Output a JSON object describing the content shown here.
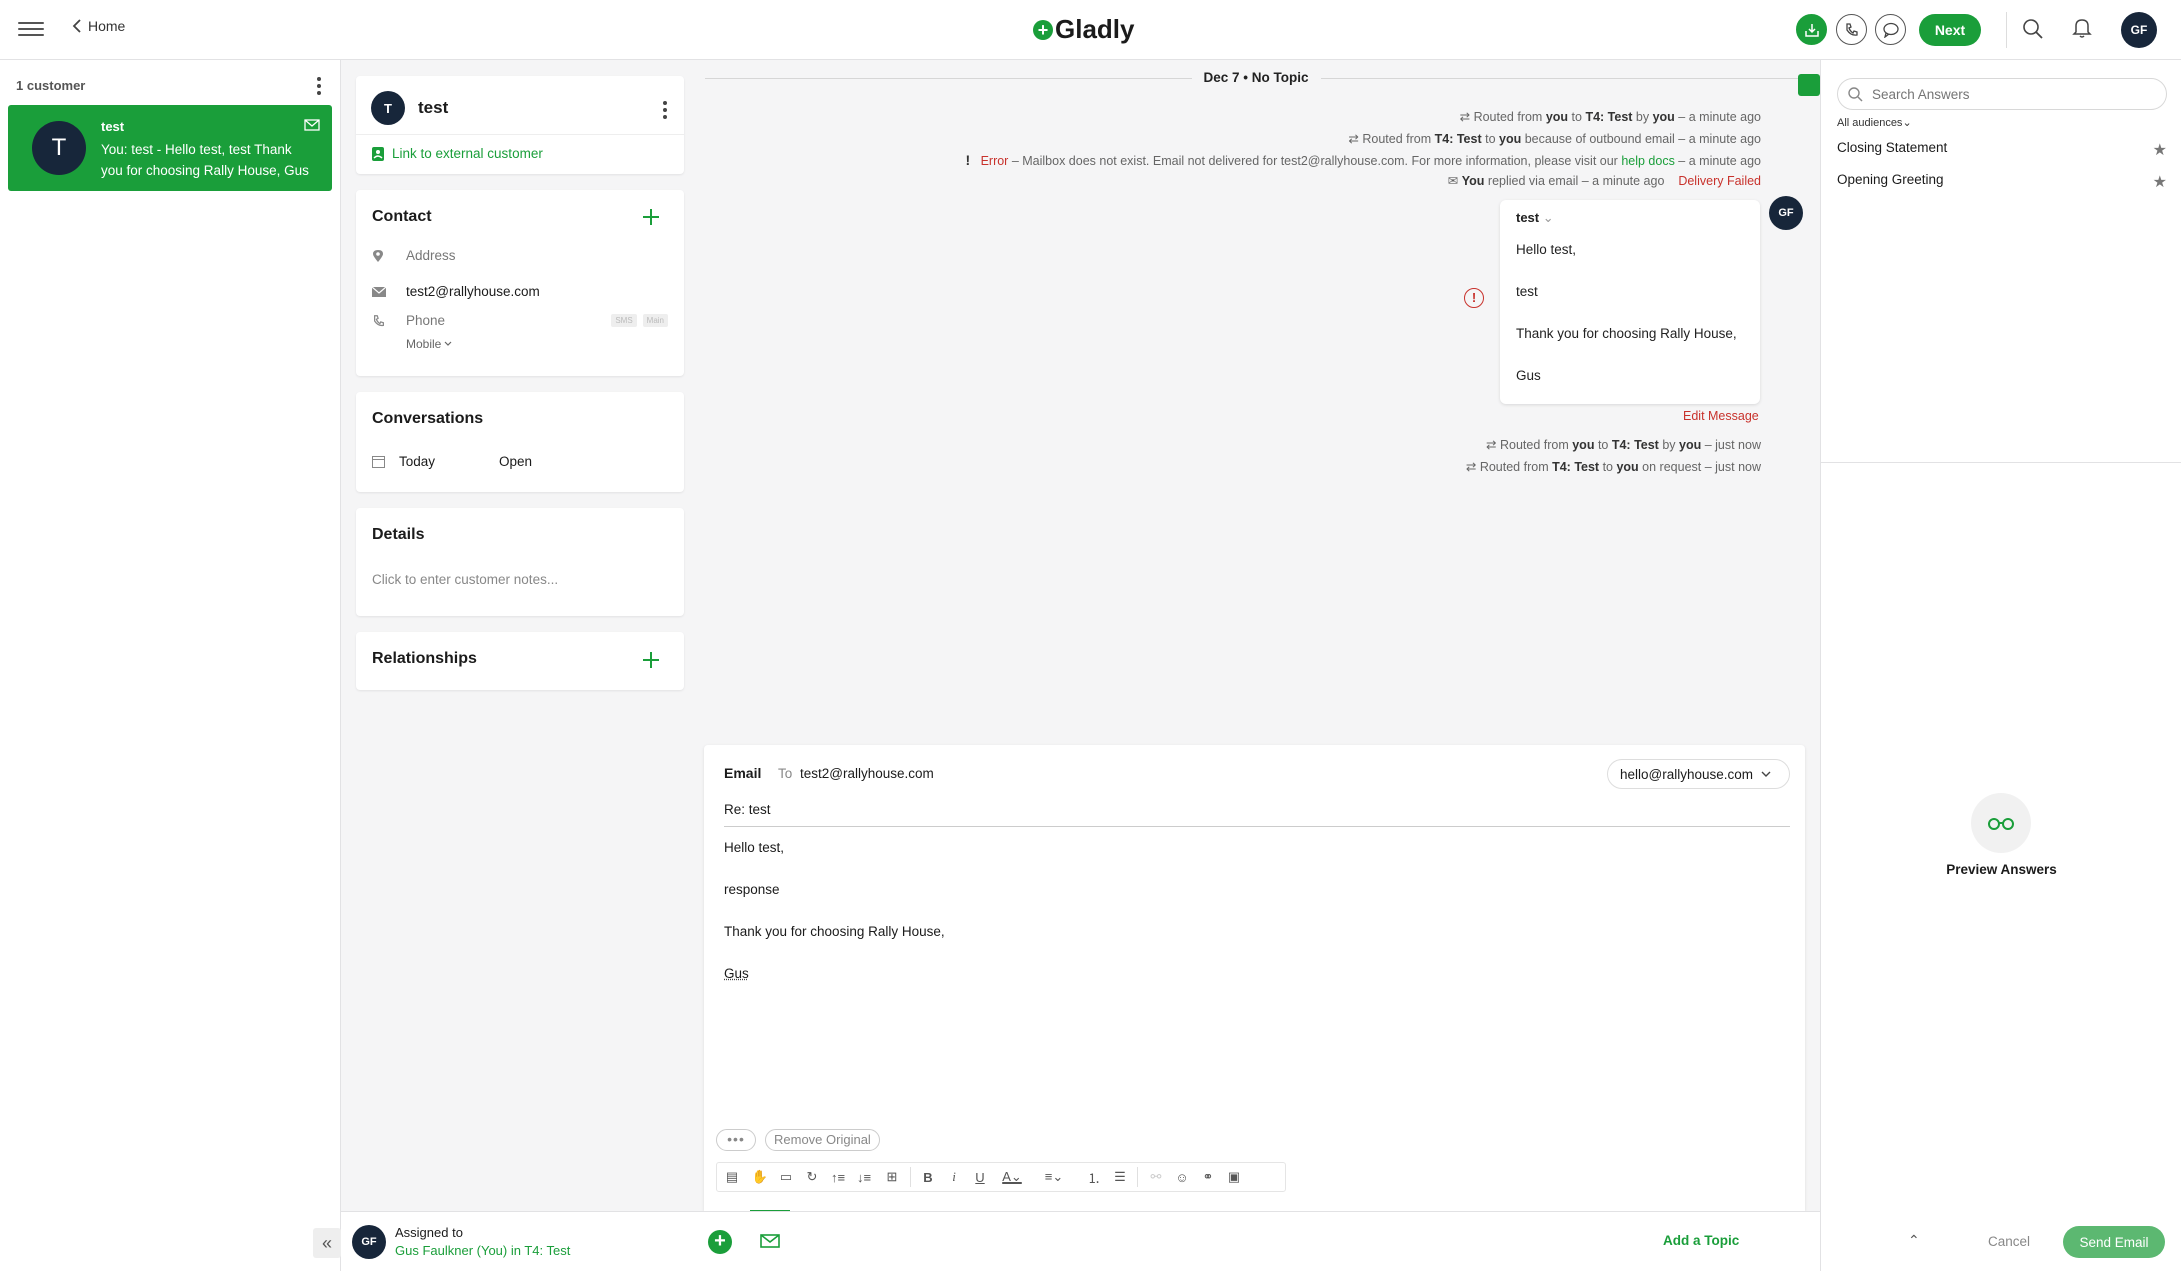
{
  "topbar": {
    "home_label": "Home",
    "brand": "Gladly",
    "next_label": "Next",
    "avatar_initials": "GF"
  },
  "customers": {
    "count_label": "1 customer",
    "items": [
      {
        "initial": "T",
        "name": "test",
        "preview": "You: test - Hello test, test Thank you for choosing Rally House, Gus"
      }
    ]
  },
  "profile": {
    "initial": "T",
    "name": "test",
    "link_external": "Link to external customer"
  },
  "contact": {
    "title": "Contact",
    "address_placeholder": "Address",
    "email": "test2@rallyhouse.com",
    "phone_placeholder": "Phone",
    "sms_tag": "SMS",
    "main_tag": "Main",
    "phone_type": "Mobile"
  },
  "conversations": {
    "title": "Conversations",
    "items": [
      {
        "date": "Today",
        "status": "Open"
      }
    ]
  },
  "details": {
    "title": "Details",
    "notes_placeholder": "Click to enter customer notes..."
  },
  "relationships": {
    "title": "Relationships"
  },
  "feed": {
    "date_header": "Dec 7 • No Topic",
    "ev1": {
      "a": "Routed from ",
      "b": "you",
      "c": " to ",
      "d": "T4: Test",
      "e": " by ",
      "f": "you",
      "g": " – a minute ago"
    },
    "ev2": {
      "a": "Routed from ",
      "b": "T4: Test",
      "c": " to ",
      "d": "you",
      "e": " because of outbound email – a minute ago"
    },
    "ev3": {
      "error": "Error",
      "text": " – Mailbox does not exist. Email not delivered for test2@rallyhouse.com. For more information, please visit our ",
      "link": "help docs",
      "time": " – a minute ago"
    },
    "ev4": {
      "you": "You",
      "text": " replied via email – a minute ago",
      "status": "Delivery Failed"
    },
    "message": {
      "sender": "test",
      "lines": [
        "Hello test,",
        "test",
        "Thank you for choosing Rally House,",
        "Gus"
      ],
      "avatar": "GF",
      "edit": "Edit Message"
    },
    "ev5": {
      "a": "Routed from ",
      "b": "you",
      "c": " to ",
      "d": "T4: Test",
      "e": " by ",
      "f": "you",
      "g": " – just now"
    },
    "ev6": {
      "a": "Routed from ",
      "b": "T4: Test",
      "c": " to ",
      "d": "you",
      "e": " on request – just now"
    }
  },
  "composer": {
    "channel": "Email",
    "to_label": "To",
    "to_value": "test2@rallyhouse.com",
    "from": "hello@rallyhouse.com",
    "subject": "Re: test",
    "body": [
      "Hello test,",
      "response",
      "Thank you for choosing Rally House,",
      "Gus"
    ],
    "remove_original": "Remove Original"
  },
  "footer": {
    "assigned_label": "Assigned to",
    "assignee": "Gus Faulkner (You) in T4: Test",
    "avatar": "GF",
    "add_topic": "Add a Topic",
    "cancel": "Cancel",
    "send": "Send Email"
  },
  "answers": {
    "search_placeholder": "Search Answers",
    "audience": "All audiences",
    "items": [
      {
        "label": "Closing Statement"
      },
      {
        "label": "Opening Greeting"
      }
    ],
    "preview_label": "Preview Answers"
  },
  "colors": {
    "brand_green": "#1a9e3a",
    "navy": "#17263a",
    "error_red": "#c8322c"
  }
}
